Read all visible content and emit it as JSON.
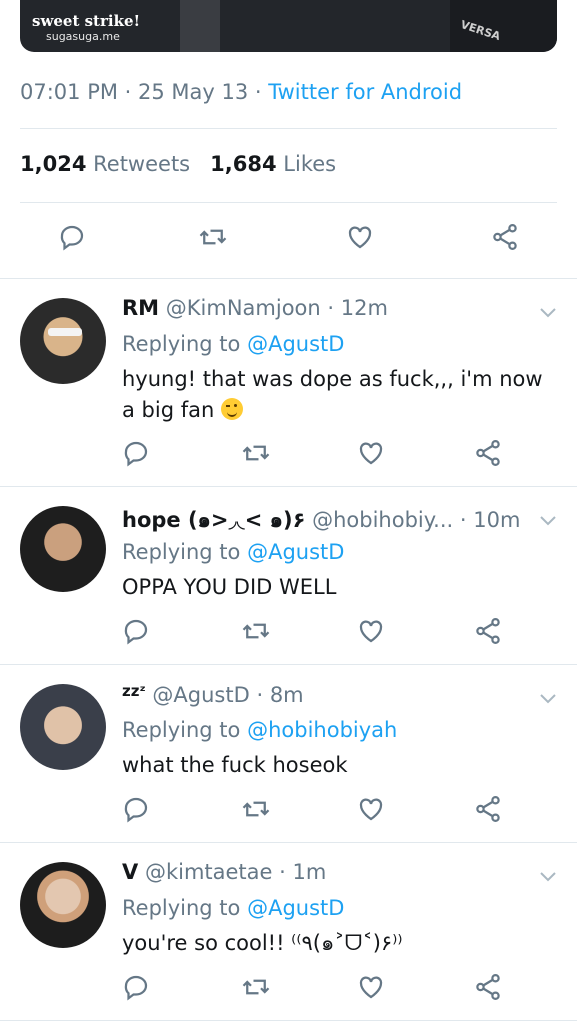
{
  "media": {
    "caption_line1": "sweet strike!",
    "caption_line2": "sugasuga.me",
    "caption_line3": "VERSA"
  },
  "tweet_meta": {
    "time": "07:01 PM",
    "date": "25 May 13",
    "source": "Twitter for Android"
  },
  "stats": {
    "retweets_count": "1,024",
    "retweets_label": "Retweets",
    "likes_count": "1,684",
    "likes_label": "Likes"
  },
  "replies": [
    {
      "name": "RM",
      "handle": "@KimNamjoon",
      "time": "12m",
      "replying_label": "Replying to",
      "replying_to": "@AgustD",
      "text": "hyung! that was dope as fuck,,, i'm now a big fan"
    },
    {
      "name": "hope (๑>◞◟< ๑)۶",
      "handle": "@hobihobiy...",
      "time": "10m",
      "replying_label": "Replying to",
      "replying_to": "@AgustD",
      "text": "OPPA YOU DID WELL"
    },
    {
      "name": "zzᶻ",
      "handle": "@AgustD",
      "time": "8m",
      "replying_label": "Replying to",
      "replying_to": "@hobihobiyah",
      "text": "what the fuck hoseok"
    },
    {
      "name": "V",
      "handle": "@kimtaetae",
      "time": "1m",
      "replying_label": "Replying to",
      "replying_to": "@AgustD",
      "text": "you're so cool!! ⁽⁽٩(๑˃ᗜ˂)۶⁾⁾"
    }
  ],
  "colors": {
    "accent": "#1da1f2",
    "secondary_text": "#657786",
    "primary_text": "#14171a",
    "divider": "#e1e8ed"
  }
}
